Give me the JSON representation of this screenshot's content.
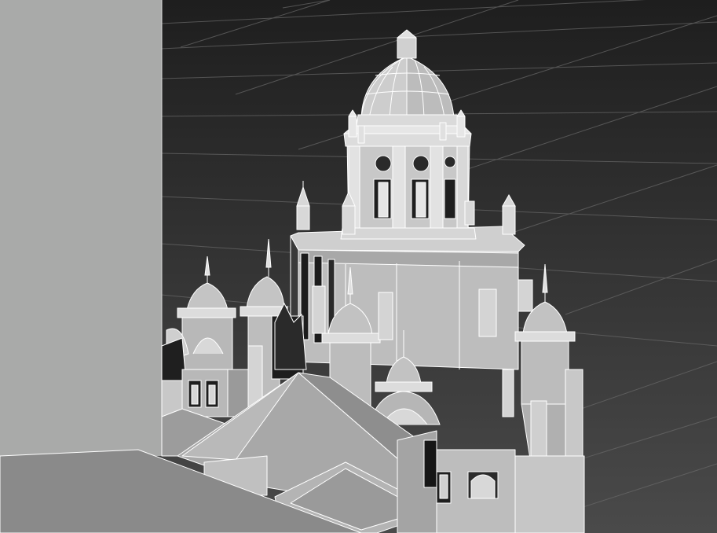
{
  "scene": {
    "kind": "3d-viewport-render",
    "subject": "domed-tower-architecture-model",
    "shading": "flat-grey-with-white-edges",
    "colors": {
      "background_top": "#1e1e1e",
      "background_bottom": "#4a4a4a",
      "grid_line": "#6a6a6a",
      "foreground_slab": "#a9aaa9",
      "wall_light": "#c9c9c9",
      "wall_mid": "#b3b3b3",
      "wall_dark": "#8e8e8e",
      "shadow": "#1a1a1a",
      "edge": "#ffffff"
    }
  }
}
